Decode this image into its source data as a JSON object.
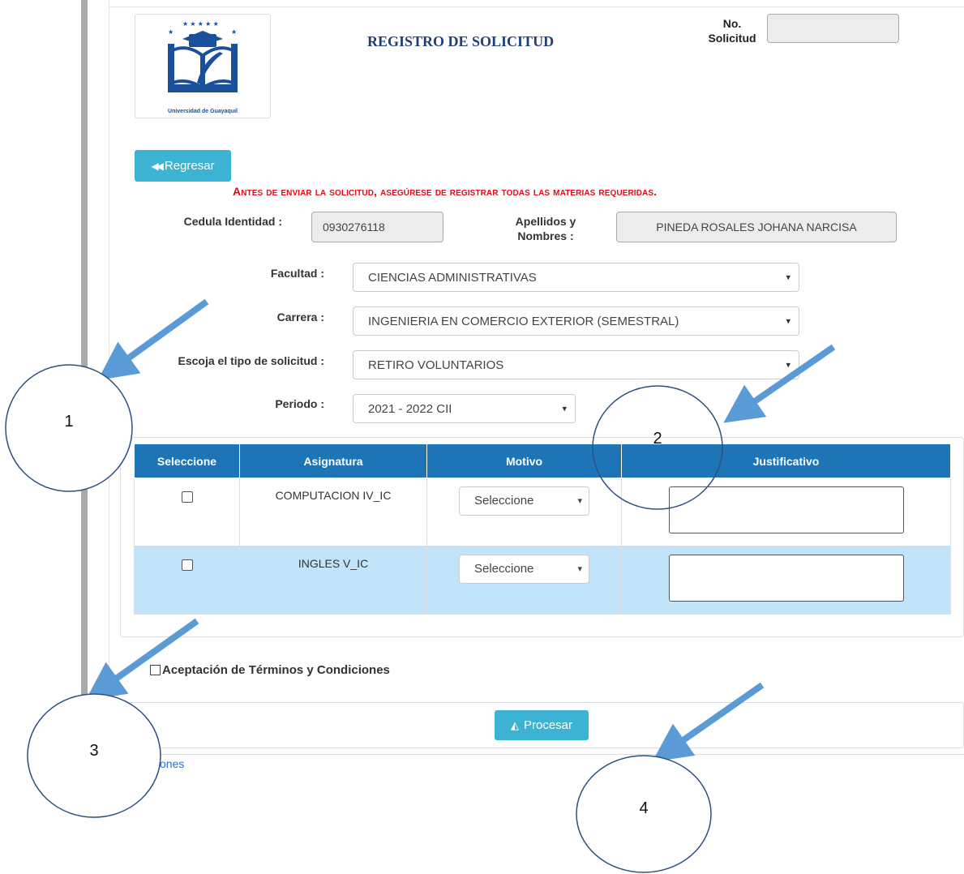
{
  "header": {
    "logo_text": "Universidad de Guayaquil",
    "title": "REGISTRO DE SOLICITUD",
    "solicitud_label_line1": "No.",
    "solicitud_label_line2": "Solicitud",
    "solicitud_value": ""
  },
  "back_button": {
    "label": "Regresar"
  },
  "warning": "Antes de enviar la solicitud, asegúrese de registrar todas las materias requeridas.",
  "form": {
    "cedula_label": "Cedula Identidad :",
    "cedula_value": "0930276118",
    "nombres_label_line1": "Apellidos y",
    "nombres_label_line2": "Nombres :",
    "nombres_value": "PINEDA ROSALES JOHANA NARCISA",
    "facultad_label": "Facultad :",
    "facultad_value": "CIENCIAS ADMINISTRATIVAS",
    "carrera_label": "Carrera :",
    "carrera_value": "INGENIERIA EN COMERCIO EXTERIOR (SEMESTRAL)",
    "tipo_label": "Escoja el tipo de solicitud  :",
    "tipo_value": "RETIRO VOLUNTARIOS",
    "periodo_label": "Periodo :",
    "periodo_value": "2021 - 2022 CII"
  },
  "table": {
    "headers": [
      "Seleccione",
      "Asignatura",
      "Motivo",
      "Justificativo"
    ],
    "rows": [
      {
        "asignatura": "COMPUTACION IV_IC",
        "motivo": "Seleccione"
      },
      {
        "asignatura": "INGLES V_IC",
        "motivo": "Seleccione"
      }
    ]
  },
  "terms_label": "Aceptación de Términos y Condiciones",
  "process_button": {
    "label": "Procesar"
  },
  "footer_link": "ones",
  "annotations": {
    "colors": {
      "arrow": "#5b9bd5",
      "circle_stroke": "#2f4f7f"
    },
    "callouts": [
      "1",
      "2",
      "3",
      "4"
    ]
  }
}
